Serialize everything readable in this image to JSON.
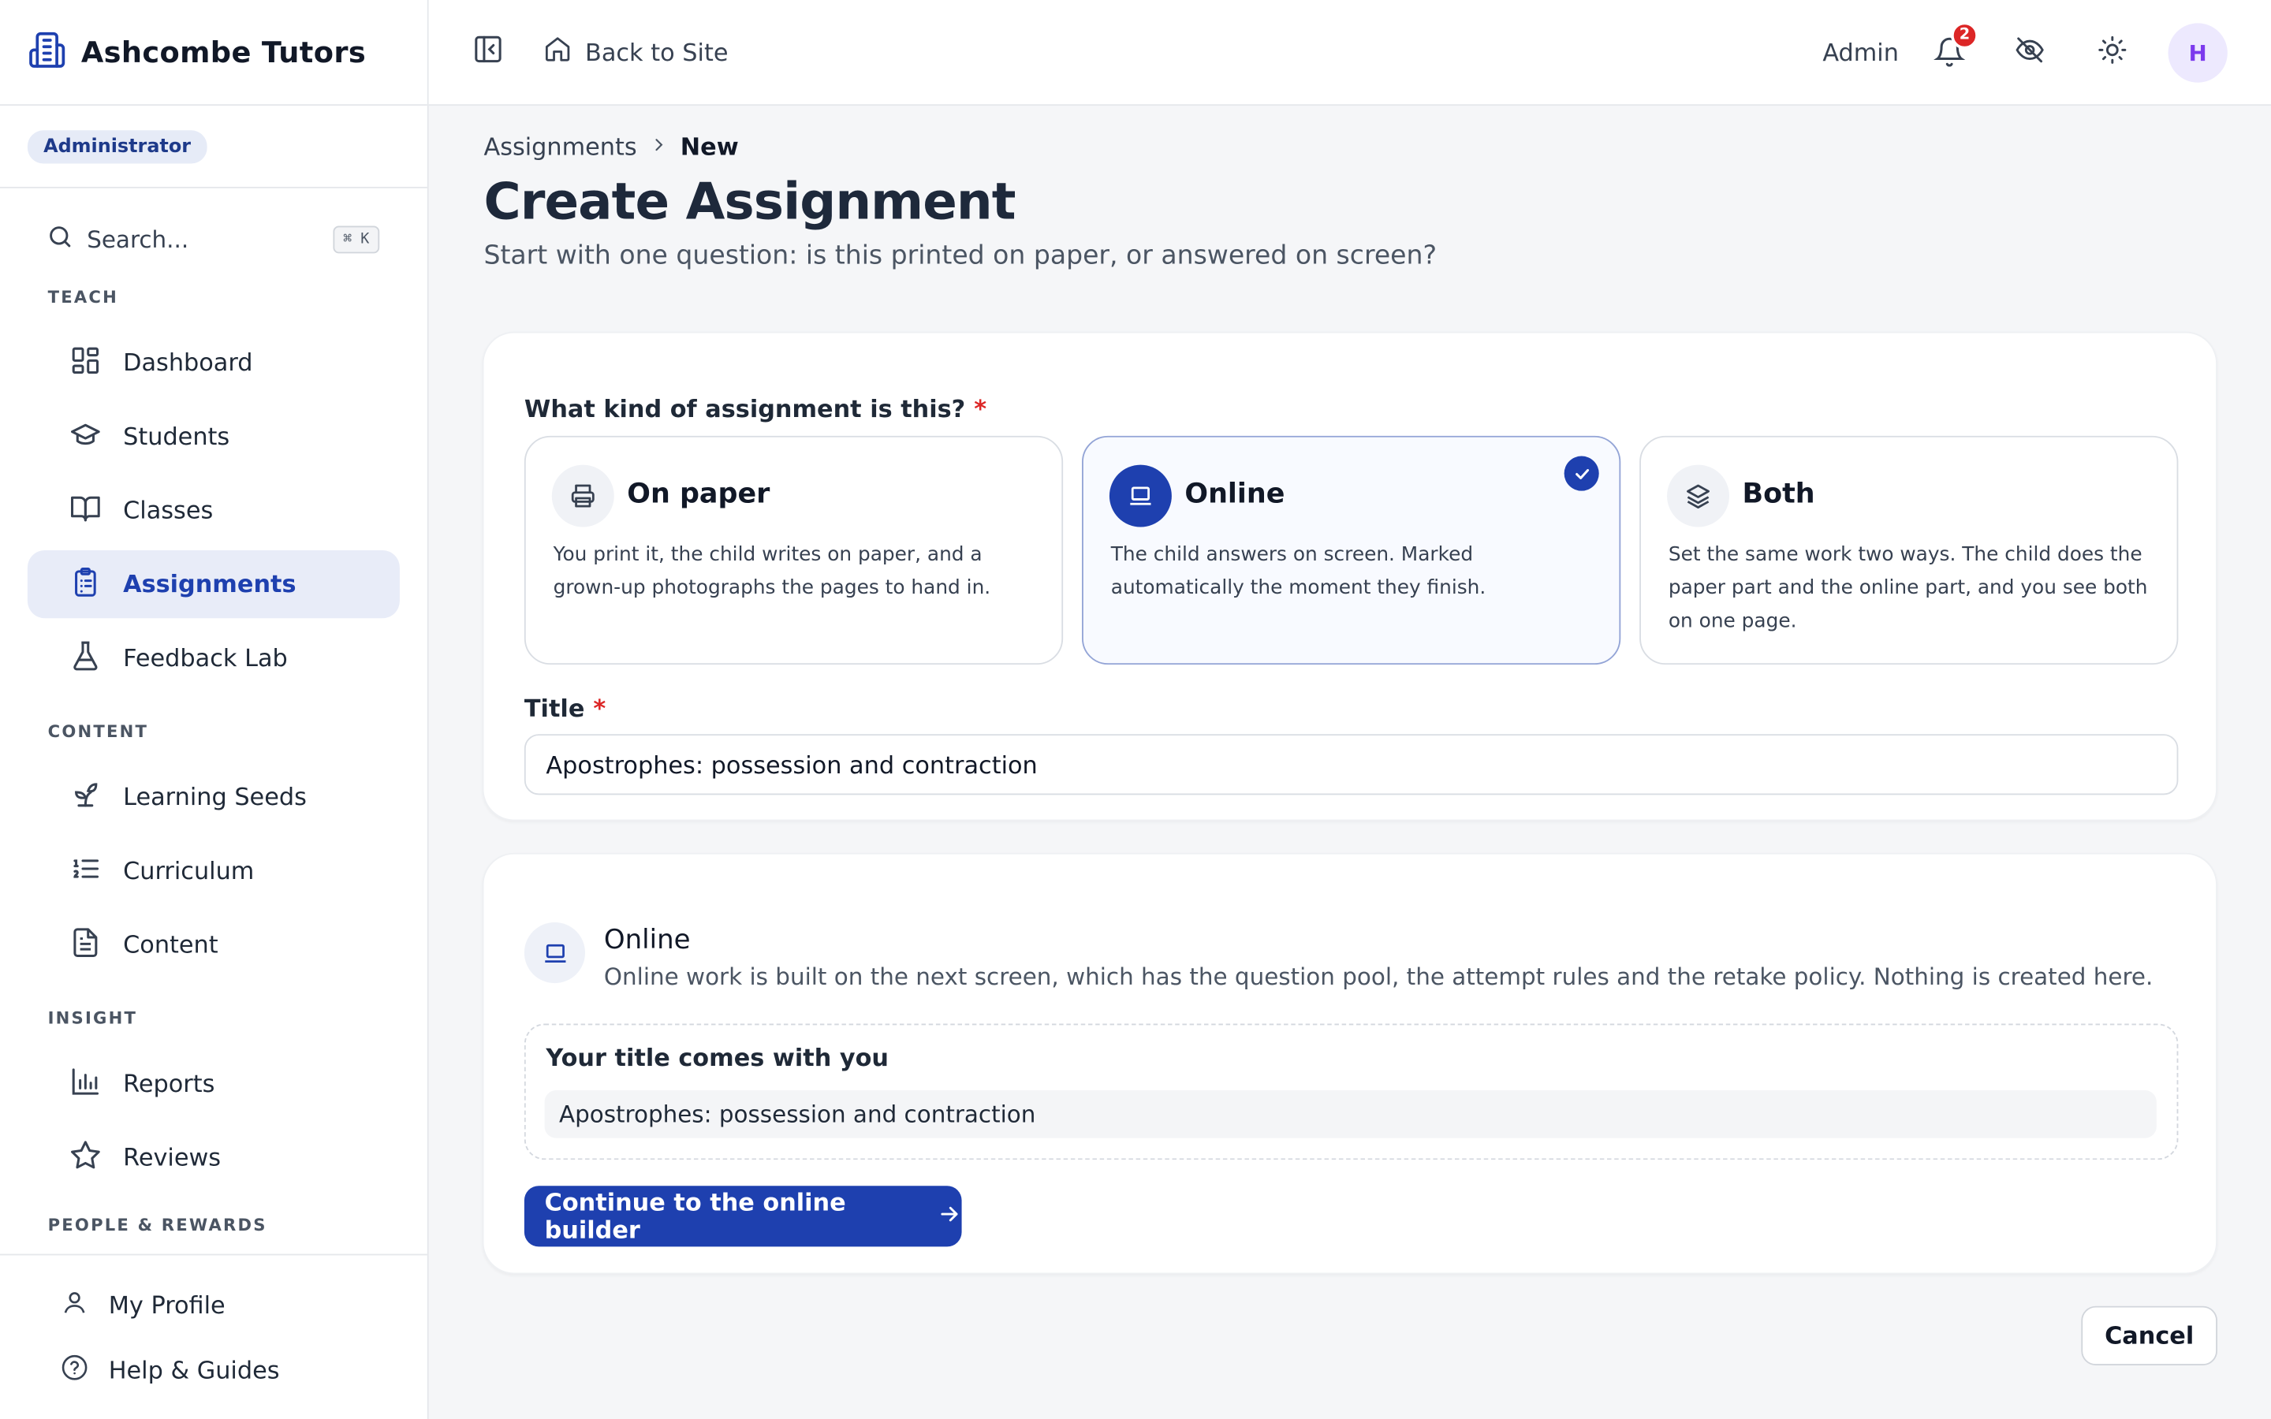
{
  "brand": {
    "name": "Ashcombe Tutors",
    "icon": "building-icon"
  },
  "role_badge": "Administrator",
  "search": {
    "label": "Search...",
    "shortcut": "⌘ K"
  },
  "sidebar": {
    "sections": [
      {
        "label": "TEACH",
        "items": [
          {
            "label": "Dashboard",
            "icon": "dashboard-icon"
          },
          {
            "label": "Students",
            "icon": "graduation-cap-icon"
          },
          {
            "label": "Classes",
            "icon": "book-open-icon"
          },
          {
            "label": "Assignments",
            "icon": "clipboard-list-icon",
            "active": true
          },
          {
            "label": "Feedback Lab",
            "icon": "flask-icon"
          }
        ]
      },
      {
        "label": "CONTENT",
        "items": [
          {
            "label": "Learning Seeds",
            "icon": "sprout-icon"
          },
          {
            "label": "Curriculum",
            "icon": "list-ordered-icon"
          },
          {
            "label": "Content",
            "icon": "file-text-icon"
          }
        ]
      },
      {
        "label": "INSIGHT",
        "items": [
          {
            "label": "Reports",
            "icon": "bar-chart-icon"
          },
          {
            "label": "Reviews",
            "icon": "star-icon"
          }
        ]
      },
      {
        "label": "PEOPLE & REWARDS",
        "items": []
      }
    ],
    "bottom": [
      {
        "label": "My Profile",
        "icon": "user-icon"
      },
      {
        "label": "Help & Guides",
        "icon": "help-circle-icon"
      }
    ]
  },
  "topbar": {
    "back_label": "Back to Site",
    "admin_label": "Admin",
    "notification_count": "2",
    "avatar_initial": "H"
  },
  "breadcrumb": {
    "parent": "Assignments",
    "current": "New"
  },
  "page": {
    "title": "Create Assignment",
    "subtitle": "Start with one question: is this printed on paper, or answered on screen?"
  },
  "form": {
    "kind_label": "What kind of assignment is this?",
    "required_mark": "*",
    "options": [
      {
        "title": "On paper",
        "icon": "printer-icon",
        "desc": "You print it, the child writes on paper, and a grown-up photographs the pages to hand in.",
        "selected": false
      },
      {
        "title": "Online",
        "icon": "laptop-icon",
        "desc": "The child answers on screen. Marked automatically the moment they finish.",
        "selected": true
      },
      {
        "title": "Both",
        "icon": "layers-icon",
        "desc": "Set the same work two ways. The child does the paper part and the online part, and you see both on one page.",
        "selected": false
      }
    ],
    "title_label": "Title",
    "title_value": "Apostrophes: possession and contraction"
  },
  "online_panel": {
    "title": "Online",
    "desc": "Online work is built on the next screen, which has the question pool, the attempt rules and the retake policy. Nothing is created here.",
    "carry_title": "Your title comes with you",
    "carry_value": "Apostrophes: possession and contraction",
    "continue_label": "Continue to the online builder"
  },
  "cancel_label": "Cancel",
  "colors": {
    "accent": "#1e40af",
    "badge": "#dc2626",
    "avatar_bg": "#ede9fe",
    "avatar_fg": "#7c3aed"
  }
}
